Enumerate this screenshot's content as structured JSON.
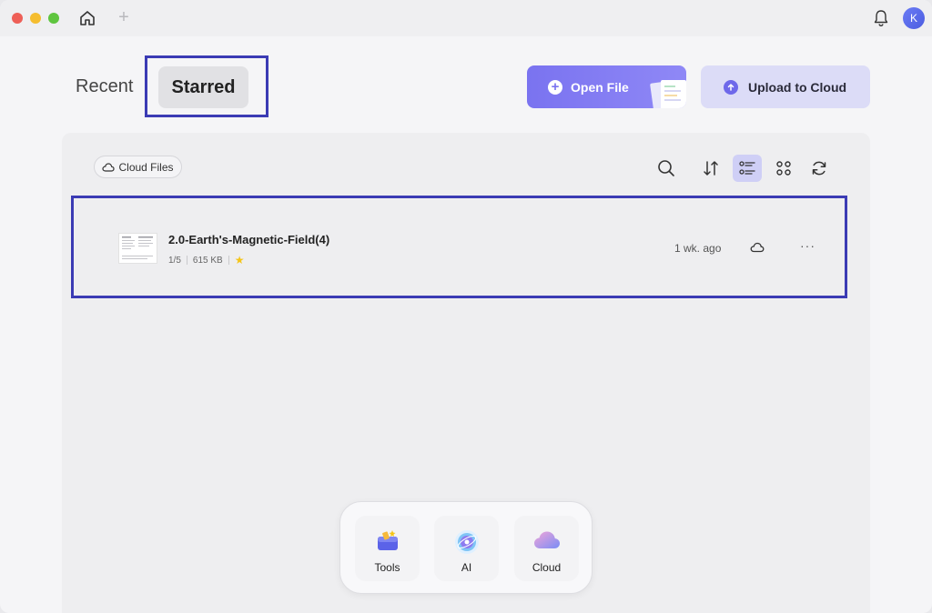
{
  "titlebar": {
    "avatar_letter": "K",
    "new_tab_symbol": "+"
  },
  "header": {
    "tabs": [
      {
        "label": "Recent",
        "active": false
      },
      {
        "label": "Starred",
        "active": true
      }
    ],
    "open_file_label": "Open File",
    "upload_label": "Upload to Cloud"
  },
  "toolbar": {
    "cloud_files_label": "Cloud Files",
    "icons": [
      "search-icon",
      "sort-icon",
      "list-view-icon",
      "grid-view-icon",
      "refresh-icon"
    ]
  },
  "files": [
    {
      "name": "2.0-Earth's-Magnetic-Field(4)",
      "pages": "1/5",
      "size": "615 KB",
      "starred": true,
      "modified": "1 wk. ago"
    }
  ],
  "dock": {
    "items": [
      {
        "label": "Tools",
        "icon": "tools-icon"
      },
      {
        "label": "AI",
        "icon": "ai-icon"
      },
      {
        "label": "Cloud",
        "icon": "cloud-icon"
      }
    ]
  },
  "colors": {
    "accent": "#7a73f0",
    "highlight_border": "#3b3bb4",
    "star": "#f5c518"
  }
}
